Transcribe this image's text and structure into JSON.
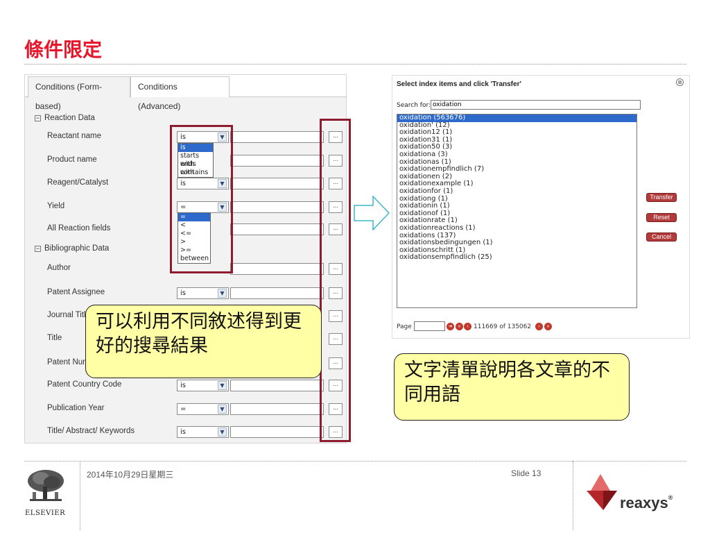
{
  "page": {
    "title": "條件限定"
  },
  "form": {
    "tabs": [
      {
        "label": "Conditions (Form-based)"
      },
      {
        "label": "Conditions (Advanced)"
      }
    ],
    "sections": {
      "reaction": "Reaction Data",
      "bibliographic": "Bibliographic Data",
      "toggle_symbol": "−"
    },
    "fields": [
      {
        "label": "Reactant name",
        "op": "is"
      },
      {
        "label": "Product name",
        "op": "is"
      },
      {
        "label": "Reagent/Catalyst",
        "op": "is"
      },
      {
        "label": "Yield",
        "op": "="
      },
      {
        "label": "All Reaction fields",
        "op": "="
      },
      {
        "label": "Author",
        "op": "is"
      },
      {
        "label": "Patent Assignee",
        "op": "is"
      },
      {
        "label": "Journal Title",
        "op": "is"
      },
      {
        "label": "Title",
        "op": "is"
      },
      {
        "label": "Patent Number",
        "op": "is"
      },
      {
        "label": "Patent Country Code",
        "op": "is"
      },
      {
        "label": "Publication Year",
        "op": "="
      },
      {
        "label": "Title/ Abstract/ Keywords",
        "op": "is"
      }
    ],
    "dots_label": "...",
    "text_dropdown": [
      "is",
      "starts with",
      "ends with",
      "contains"
    ],
    "num_dropdown": [
      "=",
      "<",
      "<=",
      ">",
      ">=",
      "between"
    ]
  },
  "callouts": {
    "left": "可以利用不同敘述得到更好的搜尋結果",
    "right": "文字清單說明各文章的不同用語"
  },
  "dialog": {
    "title": "Select index items and click 'Transfer'",
    "close_symbol": "⊗",
    "search_label": "Search for:",
    "search_value": "oxidation",
    "items": [
      "oxidation (563676)",
      "oxidation' (12)",
      "oxidation12 (1)",
      "oxidation31 (1)",
      "oxidation50 (3)",
      "oxidationa (3)",
      "oxidationas (1)",
      "oxidationempfindlich (7)",
      "oxidationen (2)",
      "oxidationexample (1)",
      "oxidationfor (1)",
      "oxidationg (1)",
      "oxidationin (1)",
      "oxidationof (1)",
      "oxidationrate (1)",
      "oxidationreactions (1)",
      "oxidations (137)",
      "oxidationsbedingungen (1)",
      "oxidationschritt (1)",
      "oxidationsempfindlich (25)"
    ],
    "buttons": {
      "transfer": "Transfer",
      "reset": "Reset",
      "cancel": "Cancel"
    },
    "pager": {
      "label": "Page",
      "info": "111669 of 135062"
    }
  },
  "footer": {
    "date": "2014年10月29日星期三",
    "slide": "Slide 13",
    "publisher": "ELSEVIER",
    "brand": "reaxys",
    "brand_mark": "®"
  },
  "colors": {
    "title": "#e8162b",
    "highlight_box": "#8e1c2e",
    "callout": "#ffffa6",
    "selection": "#2e6acb",
    "arrow": "#3ab8c8"
  }
}
